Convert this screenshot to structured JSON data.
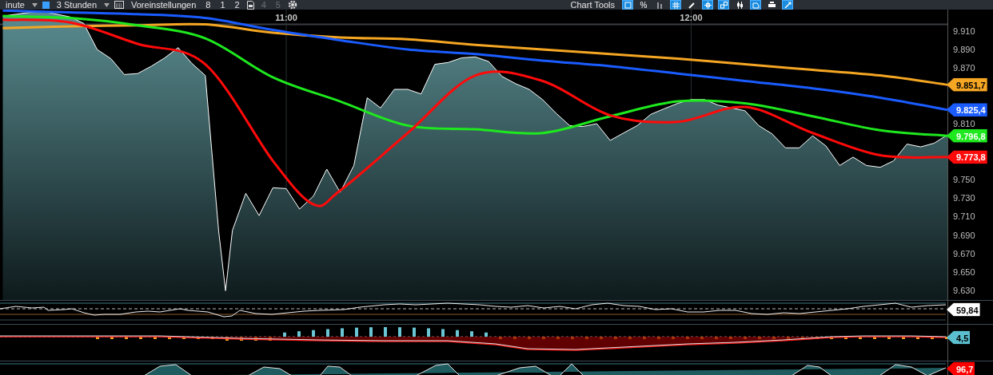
{
  "toolbar": {
    "items": [
      {
        "kind": "dropdown",
        "label": "inute"
      },
      {
        "kind": "swatch-dropdown",
        "label": "3 Stunden"
      },
      {
        "kind": "calendar",
        "label": "Voreinstellungen"
      },
      {
        "kind": "number",
        "label": "8",
        "disabled": false
      },
      {
        "kind": "number",
        "label": "1",
        "disabled": false
      },
      {
        "kind": "number",
        "label": "2",
        "disabled": false
      },
      {
        "kind": "document"
      },
      {
        "kind": "number",
        "label": "4",
        "disabled": true
      },
      {
        "kind": "number",
        "label": "5",
        "disabled": true
      },
      {
        "kind": "gear"
      }
    ],
    "chart_tools": {
      "label": "Chart Tools",
      "buttons": [
        {
          "kind": "square",
          "active": true
        },
        {
          "kind": "percent",
          "label": "%",
          "active": false
        },
        {
          "kind": "bars",
          "active": false
        },
        {
          "kind": "grid",
          "active": true
        },
        {
          "kind": "pencil",
          "active": false
        },
        {
          "kind": "crosshair",
          "active": true
        },
        {
          "kind": "squares",
          "active": true
        },
        {
          "kind": "candle",
          "active": false
        },
        {
          "kind": "shape",
          "active": true
        },
        {
          "kind": "printer",
          "active": false
        },
        {
          "kind": "pen",
          "active": true
        }
      ]
    }
  },
  "price_chart": {
    "chart_data": {
      "type": "area",
      "x": [
        10.3,
        10.333,
        10.367,
        10.4,
        10.433,
        10.467,
        10.5,
        10.533,
        10.567,
        10.6,
        10.633,
        10.667,
        10.7,
        10.733,
        10.767,
        10.8,
        10.833,
        10.85,
        10.867,
        10.9,
        10.933,
        10.967,
        11,
        11.033,
        11.067,
        11.1,
        11.133,
        11.167,
        11.2,
        11.233,
        11.267,
        11.3,
        11.333,
        11.367,
        11.4,
        11.433,
        11.467,
        11.5,
        11.533,
        11.567,
        11.6,
        11.633,
        11.667,
        11.7,
        11.733,
        11.767,
        11.8,
        11.833,
        11.867,
        11.9,
        11.933,
        11.967,
        12,
        12.033,
        12.067,
        12.1,
        12.133,
        12.167,
        12.2,
        12.233,
        12.267,
        12.3,
        12.333,
        12.367,
        12.4,
        12.433,
        12.467,
        12.5,
        12.533,
        12.567,
        12.6,
        12.633
      ],
      "xlim": [
        10.293,
        12.633
      ],
      "ylim": [
        9620,
        9933
      ],
      "xticks": [
        {
          "value": 11,
          "label": "11:00"
        },
        {
          "value": 12,
          "label": "12:00"
        }
      ],
      "yticks": [
        {
          "value": 9910,
          "label": "9.910"
        },
        {
          "value": 9890,
          "label": "9.890"
        },
        {
          "value": 9870,
          "label": "9.870"
        },
        {
          "value": 9810,
          "label": "9.810"
        },
        {
          "value": 9750,
          "label": "9.750"
        },
        {
          "value": 9730,
          "label": "9.730"
        },
        {
          "value": 9710,
          "label": "9.710"
        },
        {
          "value": 9690,
          "label": "9.690"
        },
        {
          "value": 9670,
          "label": "9.670"
        },
        {
          "value": 9650,
          "label": "9.650"
        },
        {
          "value": 9630,
          "label": "9.630"
        }
      ],
      "series": [
        {
          "color": "#ffffff",
          "values": [
            9926,
            9928,
            9930,
            9931,
            9928,
            9925,
            9918,
            9890,
            9880,
            9863,
            9864,
            9872,
            9881,
            9892,
            9875,
            9862,
            9694,
            9630,
            9695,
            9735,
            9711,
            9741,
            9740,
            9718,
            9732,
            9761,
            9736,
            9765,
            9838,
            9827,
            9847,
            9847,
            9842,
            9874,
            9876,
            9881,
            9882,
            9877,
            9861,
            9853,
            9847,
            9836,
            9821,
            9808,
            9807,
            9810,
            9792,
            9800,
            9808,
            9820,
            9826,
            9832,
            9836,
            9836,
            9830,
            9827,
            9824,
            9808,
            9799,
            9784,
            9784,
            9797,
            9786,
            9765,
            9774,
            9765,
            9763,
            9770,
            9788,
            9785,
            9789,
            9798
          ]
        },
        {
          "type": "line",
          "color": "#f5a623",
          "values": [
            9913,
            null,
            null,
            null,
            null,
            9915,
            null,
            null,
            null,
            null,
            9916,
            null,
            null,
            null,
            null,
            9917,
            null,
            null,
            null,
            null,
            null,
            9908,
            null,
            null,
            null,
            null,
            9903,
            null,
            null,
            null,
            null,
            9901,
            null,
            null,
            null,
            null,
            9895,
            null,
            null,
            null,
            null,
            9890,
            null,
            null,
            null,
            null,
            9885,
            null,
            null,
            null,
            null,
            9880,
            null,
            null,
            null,
            null,
            9874,
            null,
            null,
            null,
            null,
            9868,
            null,
            null,
            null,
            null,
            9862,
            null,
            null,
            null,
            null,
            9852
          ]
        },
        {
          "type": "line",
          "color": "#1a5cff",
          "values": [
            9932,
            null,
            null,
            null,
            null,
            9930,
            null,
            null,
            null,
            null,
            9928,
            null,
            null,
            null,
            null,
            9924,
            null,
            null,
            null,
            null,
            null,
            9911,
            null,
            null,
            null,
            null,
            9900,
            null,
            null,
            null,
            null,
            9890,
            null,
            null,
            null,
            null,
            9885,
            null,
            null,
            null,
            null,
            9878,
            null,
            null,
            null,
            null,
            9872,
            null,
            null,
            null,
            null,
            9864,
            null,
            null,
            null,
            null,
            9856,
            null,
            null,
            null,
            null,
            9848,
            null,
            null,
            null,
            null,
            9838,
            null,
            null,
            null,
            null,
            9825
          ]
        },
        {
          "type": "line",
          "color": "#1ee81e",
          "values": [
            9926,
            null,
            null,
            null,
            null,
            9924,
            null,
            null,
            null,
            null,
            9916,
            null,
            null,
            null,
            null,
            9902,
            null,
            null,
            null,
            null,
            null,
            9860,
            null,
            null,
            null,
            null,
            9834,
            null,
            null,
            null,
            null,
            9808,
            null,
            null,
            null,
            null,
            9804,
            null,
            null,
            null,
            null,
            9800,
            null,
            null,
            null,
            null,
            9818,
            null,
            null,
            null,
            null,
            9834,
            null,
            null,
            null,
            null,
            9832,
            null,
            null,
            null,
            null,
            9818,
            null,
            null,
            null,
            null,
            9803,
            null,
            null,
            null,
            null,
            9797
          ]
        },
        {
          "type": "line",
          "color": "#ff0a0a",
          "values": [
            9922,
            null,
            null,
            null,
            null,
            9919,
            null,
            null,
            null,
            null,
            9896,
            null,
            null,
            null,
            null,
            9874,
            null,
            null,
            null,
            null,
            null,
            9770,
            null,
            null,
            9723,
            null,
            9738,
            null,
            null,
            null,
            null,
            9800,
            null,
            null,
            null,
            null,
            9862,
            null,
            null,
            null,
            null,
            9856,
            null,
            null,
            null,
            null,
            9819,
            null,
            null,
            null,
            null,
            9812,
            null,
            null,
            null,
            null,
            9828,
            null,
            null,
            null,
            null,
            9800,
            null,
            null,
            null,
            null,
            9776,
            null,
            null,
            null,
            null,
            9774
          ]
        }
      ]
    },
    "price_tags": [
      {
        "value": "9.851,7",
        "color": "#f5a623"
      },
      {
        "value": "9.825,4",
        "color": "#1a5cff"
      },
      {
        "value": "9.796,8",
        "color": "#1ee81e"
      },
      {
        "value": "9.773,8",
        "color": "#ff0a0a"
      }
    ]
  },
  "indicators": [
    {
      "kind": "oscillator",
      "tag": {
        "value": "59,84",
        "color": "#ffffff"
      }
    },
    {
      "kind": "histogram",
      "tag": {
        "value": "4,5",
        "color": "#5bbfcf"
      }
    },
    {
      "kind": "stochastic",
      "tag": {
        "value": "96,7",
        "color": "#ff0000"
      }
    }
  ]
}
